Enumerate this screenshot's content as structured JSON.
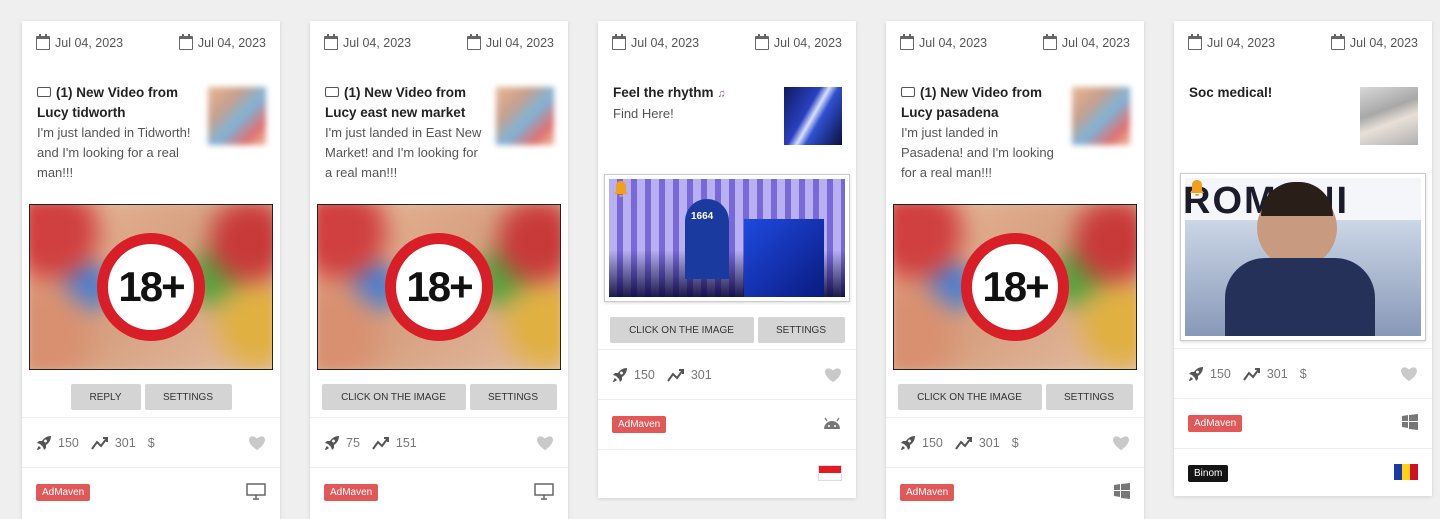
{
  "cards": [
    {
      "date_start": "Jul 04, 2023",
      "date_end": "Jul 04, 2023",
      "title": "(1) New Video from Lucy tidworth",
      "description": "I'm just landed in Tidworth! and I'm looking for a real man!!!",
      "creative": "18+",
      "buttons": [
        "REPLY",
        "SETTINGS"
      ],
      "stats": {
        "impressions": "150",
        "clicks": "301",
        "cost": "$"
      },
      "network": "AdMaven",
      "device": "desktop-icon"
    },
    {
      "date_start": "Jul 04, 2023",
      "date_end": "Jul 04, 2023",
      "title": "(1) New Video from Lucy east new market",
      "description": "I'm just landed in East New Market! and I'm looking for a real man!!!",
      "creative": "18+",
      "buttons": [
        "CLICK ON THE IMAGE",
        "SETTINGS"
      ],
      "stats": {
        "impressions": "75",
        "clicks": "151"
      },
      "network": "AdMaven",
      "device": "desktop-icon"
    },
    {
      "date_start": "Jul 04, 2023",
      "date_end": "Jul 04, 2023",
      "title": "Feel the rhythm",
      "description": "Find Here!",
      "image_text": "1664",
      "buttons": [
        "CLICK ON THE IMAGE",
        "SETTINGS"
      ],
      "stats": {
        "impressions": "150",
        "clicks": "301"
      },
      "network": "AdMaven",
      "device": "android-icon",
      "country": "indonesia-flag"
    },
    {
      "date_start": "Jul 04, 2023",
      "date_end": "Jul 04, 2023",
      "title": "(1) New Video from Lucy pasadena",
      "description": "I'm just landed in Pasadena! and I'm looking for a real man!!!",
      "creative": "18+",
      "buttons": [
        "CLICK ON THE IMAGE",
        "SETTINGS"
      ],
      "stats": {
        "impressions": "150",
        "clicks": "301",
        "cost": "$"
      },
      "network": "AdMaven",
      "device": "windows-icon"
    },
    {
      "date_start": "Jul 04, 2023",
      "date_end": "Jul 04, 2023",
      "title": "Soc medical!",
      "image_text": "ROMANI",
      "stats": {
        "impressions": "150",
        "clicks": "301",
        "cost": "$"
      },
      "network": "AdMaven",
      "device": "windows-icon",
      "tracker": "Binom",
      "country": "romania-flag"
    }
  ],
  "colors": {
    "tag": "#e25758",
    "badge_ring": "#d81e26",
    "button": "#d4d4d4"
  }
}
